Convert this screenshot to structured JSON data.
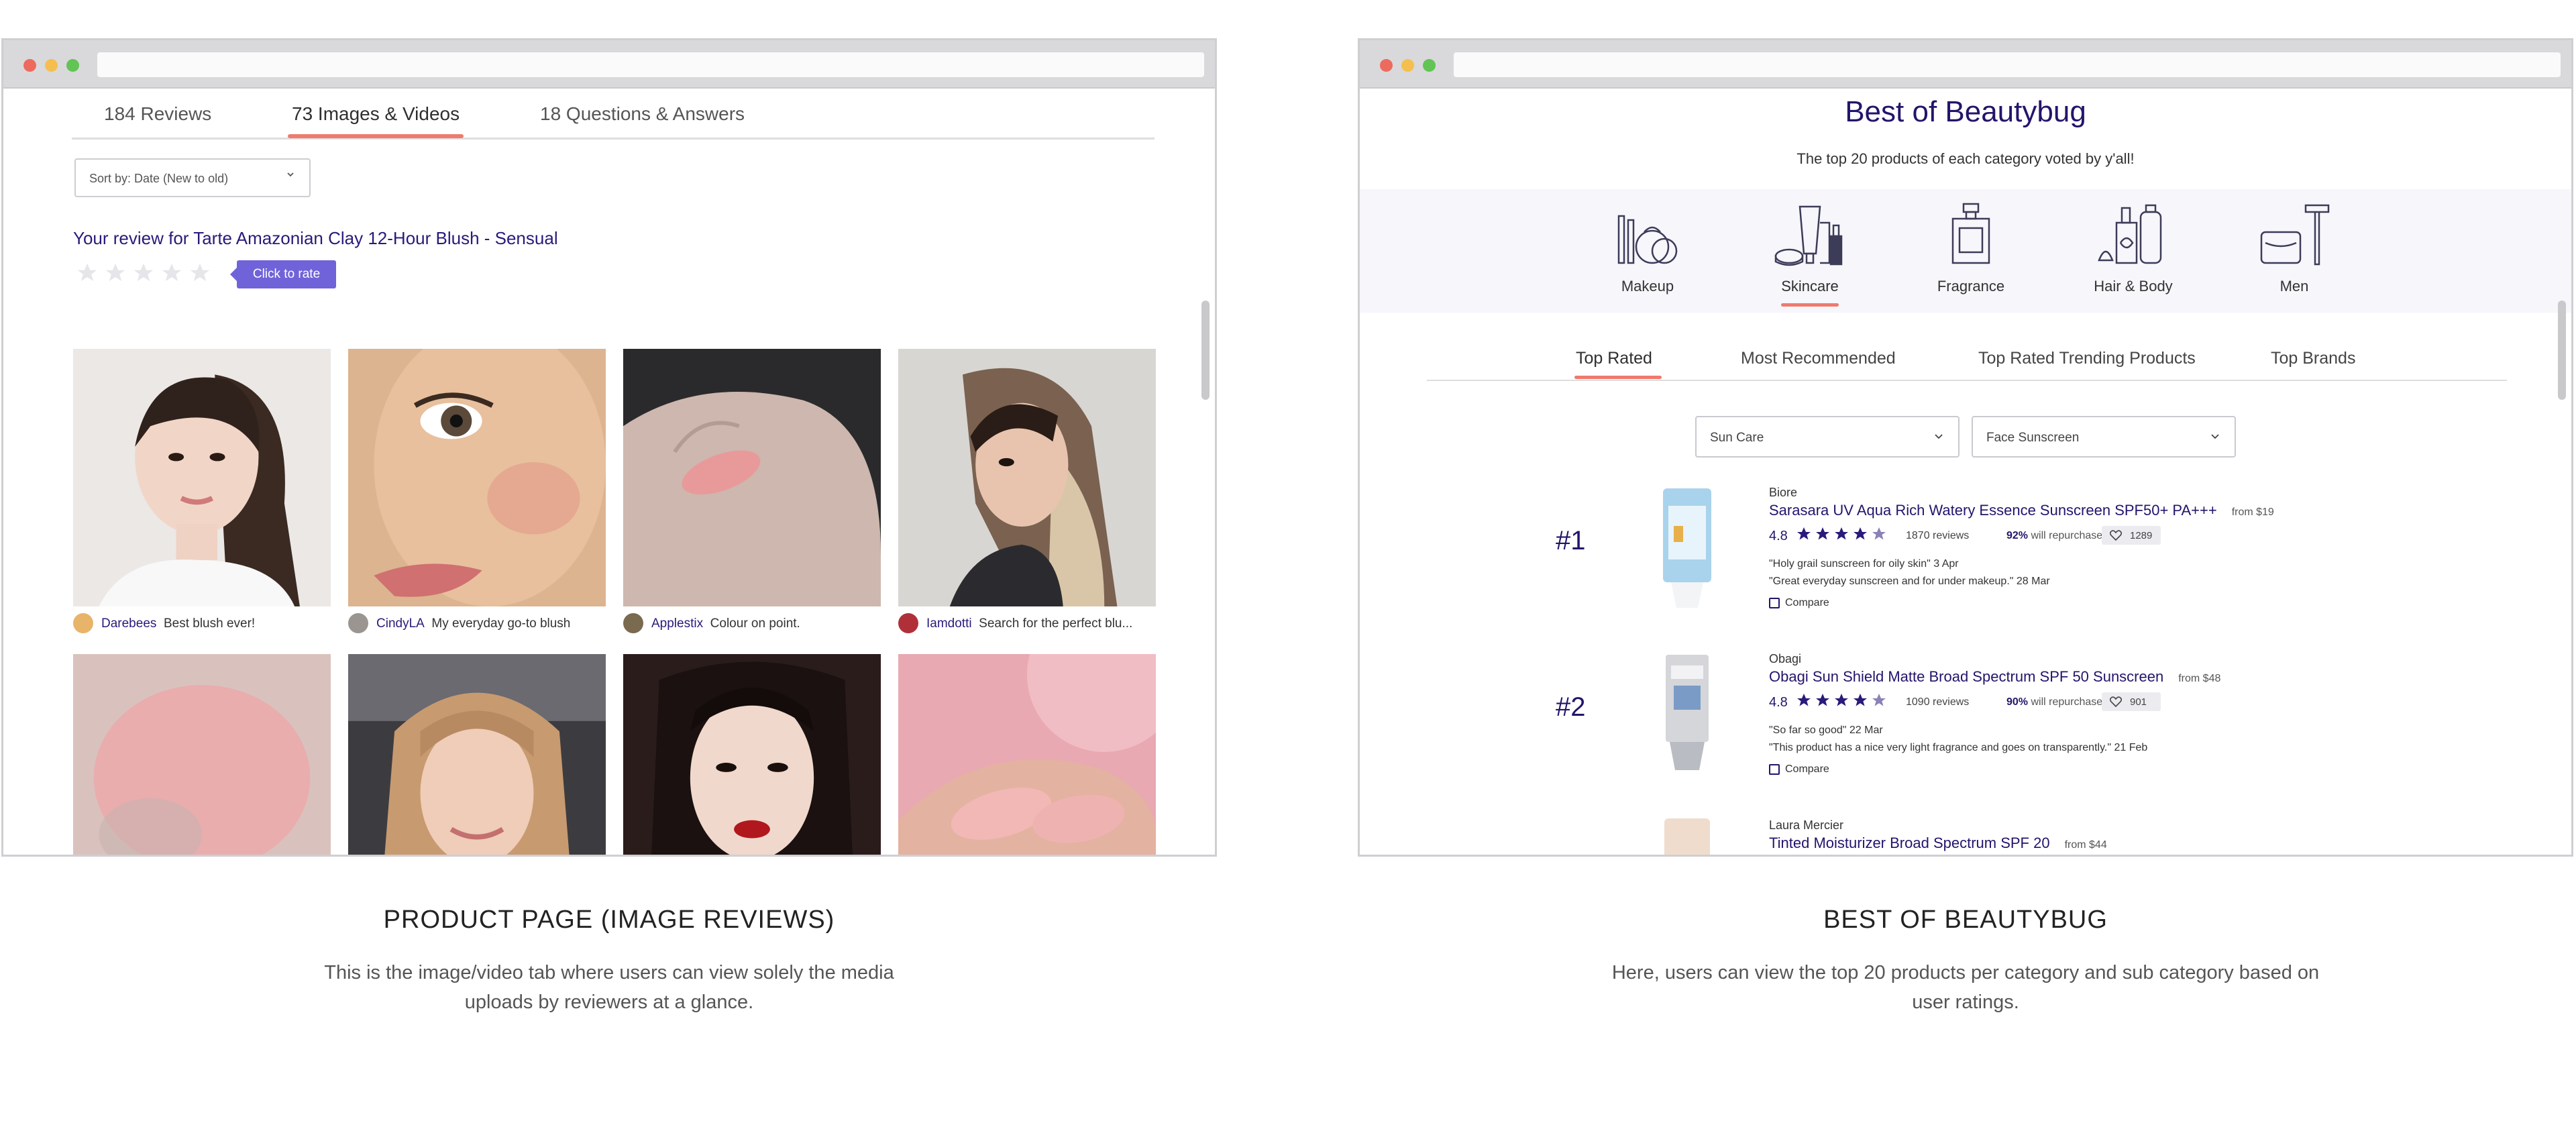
{
  "left_window": {
    "tabs": [
      "184 Reviews",
      "73 Images & Videos",
      "18 Questions & Answers"
    ],
    "active_tab": 1,
    "sort_label": "Sort by: Date (New to old)",
    "review_prompt": "Your review for Tarte Amazonian Clay 12-Hour Blush - Sensual",
    "rate_tooltip": "Click to rate",
    "star_count": 5,
    "media": [
      {
        "user": "Darebees",
        "note": "Best blush ever!"
      },
      {
        "user": "CindyLA",
        "note": "My everyday go-to blush"
      },
      {
        "user": "Applestix",
        "note": "Colour on point."
      },
      {
        "user": "Iamdotti",
        "note": "Search for the perfect blu..."
      }
    ]
  },
  "right_window": {
    "title": "Best of Beautybug",
    "subtitle": "The top 20 products of each category voted by y'all!",
    "categories": [
      {
        "label": "Makeup",
        "icon": "makeup-icon"
      },
      {
        "label": "Skincare",
        "icon": "skincare-icon"
      },
      {
        "label": "Fragrance",
        "icon": "fragrance-icon"
      },
      {
        "label": "Hair & Body",
        "icon": "hair-body-icon"
      },
      {
        "label": "Men",
        "icon": "men-icon"
      }
    ],
    "active_category": 1,
    "sub_tabs": [
      "Top Rated",
      "Most Recommended",
      "Top Rated Trending Products",
      "Top Brands"
    ],
    "active_sub_tab": 0,
    "filter_category": "Sun Care",
    "filter_subcategory": "Face Sunscreen",
    "accent_color": "#24146b",
    "products": [
      {
        "rank": "#1",
        "brand": "Biore",
        "name": "Sarasara UV Aqua Rich Watery Essence Sunscreen SPF50+ PA+++",
        "price": "from $19",
        "score": "4.8",
        "reviews": "1870 reviews",
        "repurchase_pct": "92%",
        "repurchase_label": "will repurchase",
        "likes": "1289",
        "quotes": [
          "\"Holy grail sunscreen for oily skin\" 3 Apr",
          "\"Great everyday sunscreen and for under makeup.\" 28 Mar"
        ],
        "compare": "Compare"
      },
      {
        "rank": "#2",
        "brand": "Obagi",
        "name": "Obagi Sun Shield Matte Broad Spectrum SPF 50 Sunscreen",
        "price": "from $48",
        "score": "4.8",
        "reviews": "1090 reviews",
        "repurchase_pct": "90%",
        "repurchase_label": "will repurchase",
        "likes": "901",
        "quotes": [
          "\"So far so good\" 22 Mar",
          "\"This product has a nice very light fragrance and goes on transparently.\" 21 Feb"
        ],
        "compare": "Compare"
      },
      {
        "brand": "Laura Mercier",
        "name": "Tinted Moisturizer Broad Spectrum SPF 20",
        "price": "from $44"
      }
    ]
  },
  "captions": {
    "left_title": "PRODUCT PAGE (IMAGE REVIEWS)",
    "left_desc_1": "This is the image/video tab where users can view solely the media",
    "left_desc_2": "uploads by reviewers at a glance.",
    "right_title": "BEST OF BEAUTYBUG",
    "right_desc_1": "Here, users can view the top 20 products per category and sub category based on",
    "right_desc_2": "user ratings."
  }
}
